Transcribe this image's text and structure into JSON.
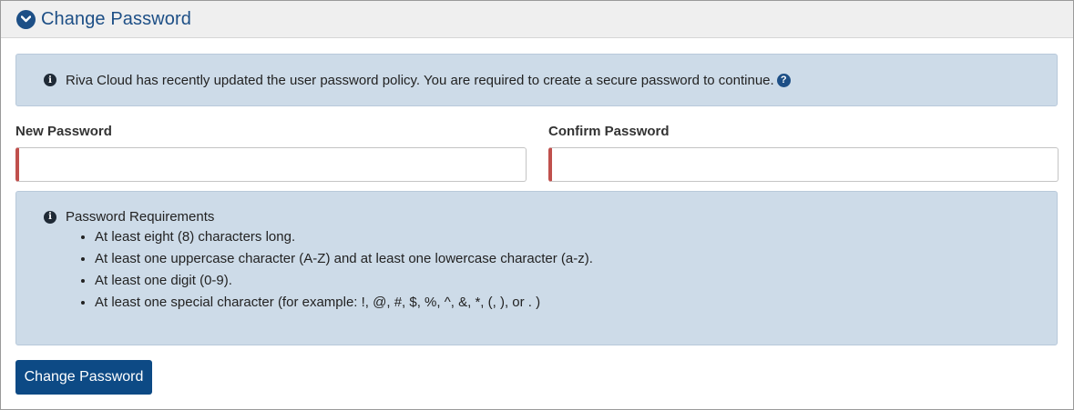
{
  "panel": {
    "title": "Change Password",
    "header_icon": "chevron-down-circle-icon"
  },
  "notice": {
    "icon": "info-icon",
    "text": "Riva Cloud has recently updated the user password policy. You are required to create a secure password to continue.",
    "help_icon": "question-circle-icon"
  },
  "form": {
    "new_password_label": "New Password",
    "new_password_value": "",
    "confirm_password_label": "Confirm Password",
    "confirm_password_value": ""
  },
  "requirements": {
    "icon": "info-icon",
    "title": "Password Requirements",
    "items": [
      "At least eight (8) characters long.",
      "At least one uppercase character (A-Z) and at least one lowercase character (a-z).",
      "At least one digit (0-9).",
      "At least one special character (for example: !, @, #, $, %, ^, &, *, (, ), or . )"
    ]
  },
  "actions": {
    "submit_label": "Change Password"
  },
  "colors": {
    "accent": "#1d4f86",
    "button": "#0d4a85",
    "alert_bg": "#cddbe8",
    "invalid_border": "#c0504d"
  }
}
